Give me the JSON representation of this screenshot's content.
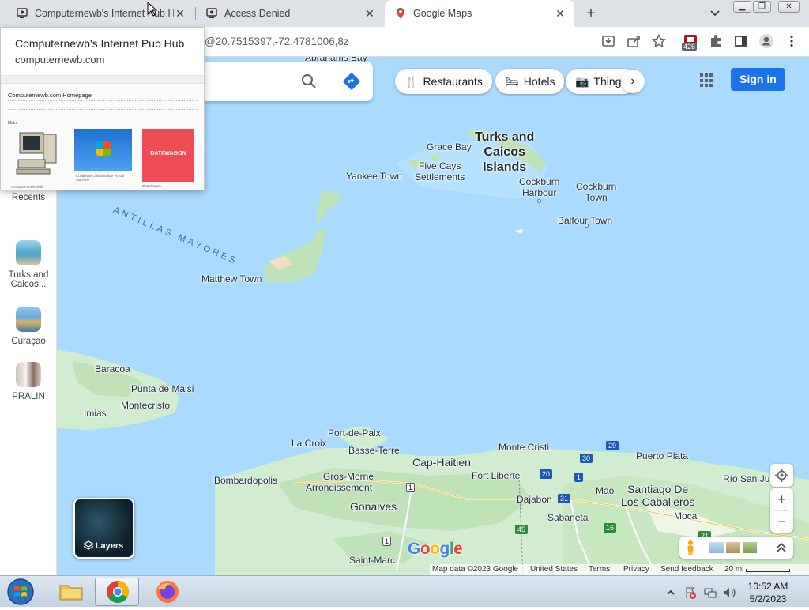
{
  "browser": {
    "tabs": [
      {
        "title": "Computernewb's Internet Pub Hub",
        "active": false
      },
      {
        "title": "Access Denied",
        "active": false
      },
      {
        "title": "Google Maps",
        "active": true
      }
    ],
    "new_tab_label": "+",
    "address_url": "@20.7515397,-72.4781006,8z",
    "extension_badge": "426"
  },
  "hovercard": {
    "title": "Computernewb's Internet Pub Hub",
    "domain": "computernewb.com",
    "thumb": {
      "heading": "Computernewb.com Homepage",
      "section": "Main",
      "items": [
        "Computernewb Wiki",
        "CollabVM Collaborative Virtual Machine",
        "DataWagon"
      ],
      "datawagon_logo": "DATAWAGON"
    }
  },
  "maps": {
    "chips": [
      {
        "label": "Restaurants",
        "icon": "fork-knife-icon"
      },
      {
        "label": "Hotels",
        "icon": "bed-icon"
      },
      {
        "label": "Things",
        "icon": "camera-icon"
      }
    ],
    "sign_in": "Sign in",
    "rail": {
      "recents": "Recents",
      "items": [
        {
          "label_line1": "Turks and",
          "label_line2": "Caicos...",
          "thumb_color": "#4aa3c9"
        },
        {
          "label_line1": "Curaçao",
          "label_line2": "",
          "thumb_color": "#6aa8d8"
        },
        {
          "label_line1": "PRALIN",
          "label_line2": "",
          "thumb_color": "#b89a88"
        }
      ]
    },
    "layers_label": "Layers",
    "google_logo": "Google",
    "labels": {
      "abrahams_bay": "Abrahams Bay",
      "turks_caicos_1": "Turks and",
      "turks_caicos_2": "Caicos",
      "turks_caicos_3": "Islands",
      "grace_bay": "Grace Bay",
      "five_cays_1": "Five Cays",
      "five_cays_2": "Settlements",
      "yankee_town": "Yankee Town",
      "cockburn_harbour_1": "Cockburn",
      "cockburn_harbour_2": "Harbour",
      "cockburn_town_1": "Cockburn",
      "cockburn_town_2": "Town",
      "balfour_town": "Balfour Town",
      "antillas": "ANTILLAS MAYORES",
      "matthew_town": "Matthew Town",
      "baracoa": "Baracoa",
      "punta_de_maisi": "Punta de Maisi",
      "montecristo": "Montecristo",
      "imias": "Imias",
      "port_de_paix": "Port-de-Paix",
      "la_croix": "La Croix",
      "basse_terre": "Basse-Terre",
      "cap_haitien": "Cap-Haitien",
      "monte_cristi": "Monte Cristi",
      "puerto_plata": "Puerto Plata",
      "bombardopolis": "Bombardopolis",
      "gros_morne": "Gros-Morne",
      "arrondissement": "Arrondissement",
      "fort_liberte": "Fort Liberte",
      "santiago_1": "Santiago De",
      "santiago_2": "Los Caballeros",
      "rio_san_juan": "Río San Jua",
      "gonaives": "Gonaives",
      "dajabon": "Dajabon",
      "mao": "Mao",
      "sabaneta": "Sabaneta",
      "moca": "Moca",
      "saint_marc": "Saint-Marc"
    },
    "route_shields": [
      "1",
      "20",
      "1",
      "31",
      "30",
      "29",
      "45",
      "16",
      "1",
      "21"
    ],
    "footer": {
      "map_data": "Map data ©2023 Google",
      "country": "United States",
      "terms": "Terms",
      "privacy": "Privacy",
      "feedback": "Send feedback",
      "scale": "20 mi"
    },
    "colors": {
      "water": "#aadaff",
      "land": "#d2ecd0",
      "land_dark": "#bfe2b9",
      "sand": "#f0e0c2",
      "accent": "#1a73e8"
    }
  },
  "taskbar": {
    "time": "10:52 AM",
    "date": "5/2/2023"
  }
}
